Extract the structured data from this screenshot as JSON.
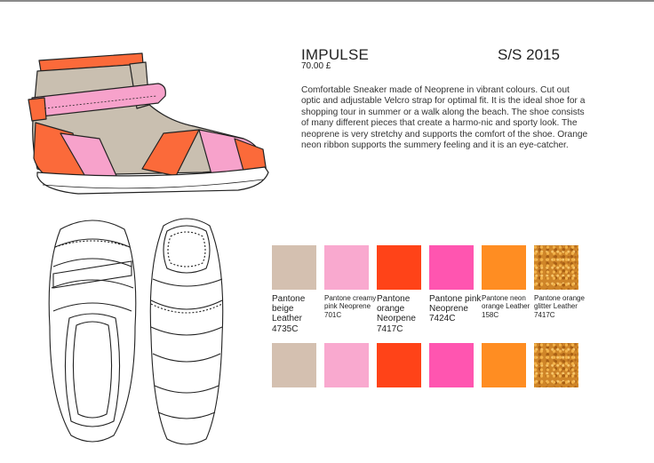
{
  "product": {
    "name": "IMPULSE",
    "price": "70.00 £",
    "season": "S/S 2015",
    "description": "Comfortable Sneaker made of Neoprene in vibrant colours. Cut out optic and adjustable Velcro strap for optimal fit. It is the ideal shoe for a shopping tour in summer or a walk along the beach. The shoe consists of many different pieces that create a harmo-nic and sporty look. The neoprene is very stretchy and supports the comfort of the shoe. Orange neon ribbon supports the summery feeling and it is an eye-catcher."
  },
  "swatches": [
    {
      "label": "Pantone beige Leather 4735C",
      "color": "#d4c0b0"
    },
    {
      "label": "Pantone creamy pink Neoprene 701C",
      "color": "#f9a9cf"
    },
    {
      "label": "Pantone orange Neorpene 7417C",
      "color": "#ff4318"
    },
    {
      "label": "Pantone pink Neoprene 7424C",
      "color": "#ff55b0"
    },
    {
      "label": "Pantone neon orange Leather 158C",
      "color": "#ff8d22"
    },
    {
      "label": "Pantone orange glitter Leather 7417C",
      "color": "#cf8528"
    }
  ],
  "colors": {
    "beige": "#c9bfb0",
    "pink": "#f7a2cb",
    "orange": "#fb6a3a",
    "neon_orange": "#ff8a2a",
    "outline": "#222222"
  }
}
